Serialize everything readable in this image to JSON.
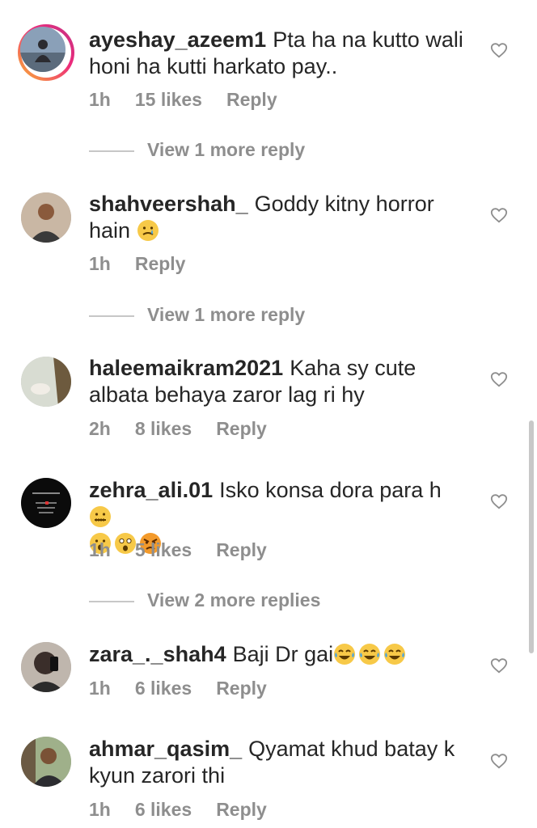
{
  "comments": [
    {
      "username": "ayeshay_azeem1",
      "text": "Pta ha na kutto wali honi ha kutti harkato pay..",
      "time": "1h",
      "likes": "15 likes",
      "reply": "Reply",
      "avatar": "woman-scenic-avatar",
      "story_ring": true
    },
    {
      "username": "shahveershah_",
      "text": "Goddy  kitny  horror hain",
      "emoji": [
        "crying-face"
      ],
      "time": "1h",
      "reply": "Reply",
      "avatar": "man-avatar"
    },
    {
      "username": "haleemaikram2021",
      "text": "Kaha sy cute albata behaya zaror lag ri hy",
      "time": "2h",
      "likes": "8 likes",
      "reply": "Reply",
      "avatar": "hand-avatar"
    },
    {
      "username": "zehra_ali.01",
      "text": "Isko konsa dora para h",
      "emoji_inline": [
        "zipper-mouth-face"
      ],
      "emoji_line": [
        "hushed-face",
        "astonished-face",
        "angry-face"
      ],
      "time": "1h",
      "likes": "5 likes",
      "reply": "Reply",
      "avatar": "black-text-avatar"
    },
    {
      "username": "zara_._shah4",
      "text": "Baji Dr gai",
      "emoji_inline": [
        "joy-face",
        "joy-face",
        "joy-face"
      ],
      "time": "1h",
      "likes": "6 likes",
      "reply": "Reply",
      "avatar": "selfie-avatar"
    },
    {
      "username": "ahmar_qasim_",
      "text": "Qyamat khud batay k kyun zarori thi",
      "time": "1h",
      "likes": "6 likes",
      "reply": "Reply",
      "avatar": "man-outdoor-avatar"
    }
  ],
  "view_more": [
    "View 1 more reply",
    "View 1 more reply",
    "View 2 more replies"
  ],
  "icons": {
    "like": "heart-outline-icon"
  },
  "colors": {
    "text": "#262626",
    "secondary": "#8e8e8e",
    "divider": "#c7c7c7"
  }
}
